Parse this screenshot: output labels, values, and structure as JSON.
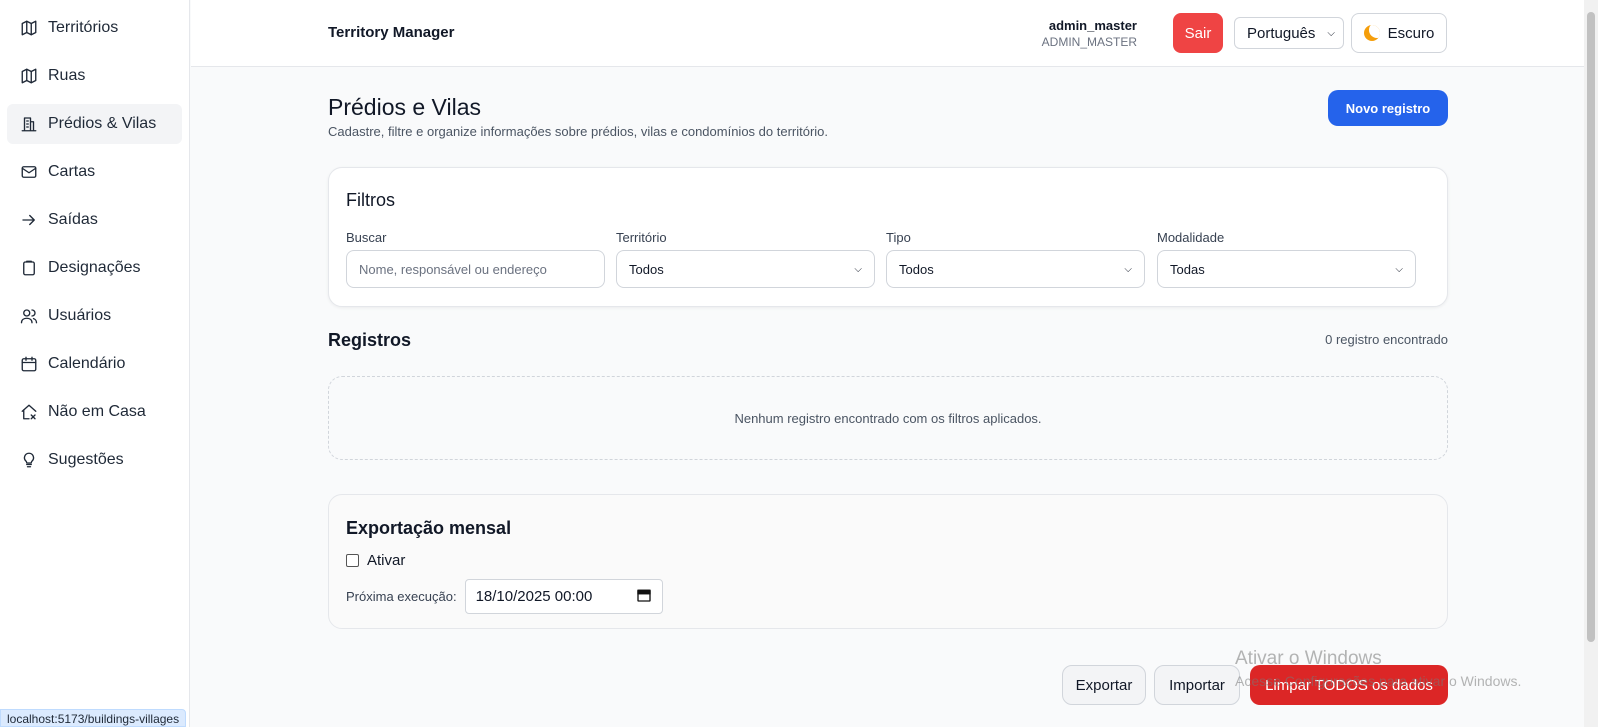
{
  "sidebar": {
    "items": [
      {
        "label": "Territórios",
        "icon": "map-icon"
      },
      {
        "label": "Ruas",
        "icon": "map-icon"
      },
      {
        "label": "Prédios & Vilas",
        "icon": "building-icon",
        "active": true
      },
      {
        "label": "Cartas",
        "icon": "mail-icon"
      },
      {
        "label": "Saídas",
        "icon": "arrow-right-icon"
      },
      {
        "label": "Designações",
        "icon": "clipboard-icon"
      },
      {
        "label": "Usuários",
        "icon": "users-icon"
      },
      {
        "label": "Calendário",
        "icon": "calendar-icon"
      },
      {
        "label": "Não em Casa",
        "icon": "house-x-icon"
      },
      {
        "label": "Sugestões",
        "icon": "lightbulb-icon"
      }
    ]
  },
  "status_url": "localhost:5173/buildings-villages",
  "header": {
    "brand": "Territory Manager",
    "user_name": "admin_master",
    "user_role": "ADMIN_MASTER",
    "logout_label": "Sair",
    "language": "Português",
    "theme_label": "Escuro"
  },
  "page": {
    "title": "Prédios e Vilas",
    "subtitle": "Cadastre, filtre e organize informações sobre prédios, vilas e condomínios do território.",
    "new_button": "Novo registro"
  },
  "filters": {
    "title": "Filtros",
    "search_label": "Buscar",
    "search_placeholder": "Nome, responsável ou endereço",
    "territory_label": "Território",
    "territory_value": "Todos",
    "type_label": "Tipo",
    "type_value": "Todos",
    "modality_label": "Modalidade",
    "modality_value": "Todas"
  },
  "records": {
    "title": "Registros",
    "count": "0 registro encontrado",
    "empty": "Nenhum registro encontrado com os filtros aplicados."
  },
  "export": {
    "title": "Exportação mensal",
    "activate_label": "Ativar",
    "next_label": "Próxima execução:",
    "next_value": "18/10/2025 00:00"
  },
  "actions": {
    "export": "Exportar",
    "import": "Importar",
    "clear": "Limpar TODOS os dados"
  },
  "watermark": {
    "title": "Ativar o Windows",
    "subtitle": "Acesse Configurações para ativar o Windows."
  },
  "colors": {
    "primary": "#2563eb",
    "danger": "#ef4444",
    "danger_dark": "#dc2626"
  }
}
